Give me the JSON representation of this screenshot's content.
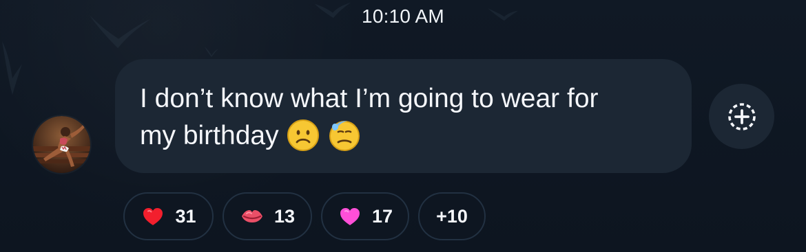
{
  "timestamp": "10:10 AM",
  "message": {
    "line_1": "I don’t know what I’m going to wear for",
    "line_2": "my birthday",
    "emoji_icons": [
      "slightly-frowning-face-icon",
      "downcast-face-with-sweat-icon"
    ]
  },
  "actions": {
    "add_reaction_icon": "add-reaction-icon"
  },
  "reactions": [
    {
      "icon": "red-heart-icon",
      "count": "31"
    },
    {
      "icon": "kiss-lips-icon",
      "count": "13"
    },
    {
      "icon": "pink-heart-icon",
      "count": "17"
    },
    {
      "label": "+10"
    }
  ],
  "colors": {
    "background": "#0f1721",
    "bubble": "#1c2734",
    "pill_border": "#223142",
    "text": "#f5f7fb"
  }
}
